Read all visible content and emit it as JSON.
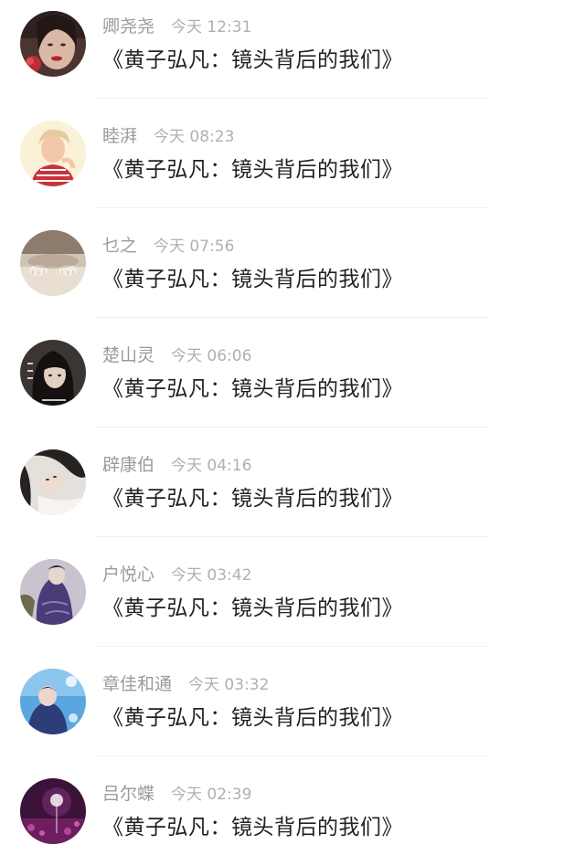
{
  "comments": [
    {
      "name": "卿尧尧",
      "time": "今天 12:31",
      "text": "《黄子弘凡：镜头背后的我们》",
      "avatar": "girl-red-lips-avatar"
    },
    {
      "name": "睦湃",
      "time": "今天 08:23",
      "text": "《黄子弘凡：镜头背后的我们》",
      "avatar": "boy-striped-shirt-avatar"
    },
    {
      "name": "乜之",
      "time": "今天 07:56",
      "text": "《黄子弘凡：镜头背后的我们》",
      "avatar": "cat-paws-avatar"
    },
    {
      "name": "楚山灵",
      "time": "今天 06:06",
      "text": "《黄子弘凡：镜头背后的我们》",
      "avatar": "dark-hair-girl-text-avatar"
    },
    {
      "name": "辟康伯",
      "time": "今天 04:16",
      "text": "《黄子弘凡：镜头背后的我们》",
      "avatar": "lying-girl-avatar"
    },
    {
      "name": "户悦心",
      "time": "今天 03:42",
      "text": "《黄子弘凡：镜头背后的我们》",
      "avatar": "purple-jacket-avatar"
    },
    {
      "name": "章佳和通",
      "time": "今天 03:32",
      "text": "《黄子弘凡：镜头背后的我们》",
      "avatar": "blue-sky-avatar"
    },
    {
      "name": "吕尔蝶",
      "time": "今天 02:39",
      "text": "《黄子弘凡：镜头背后的我们》",
      "avatar": "purple-dandelion-avatar"
    }
  ]
}
